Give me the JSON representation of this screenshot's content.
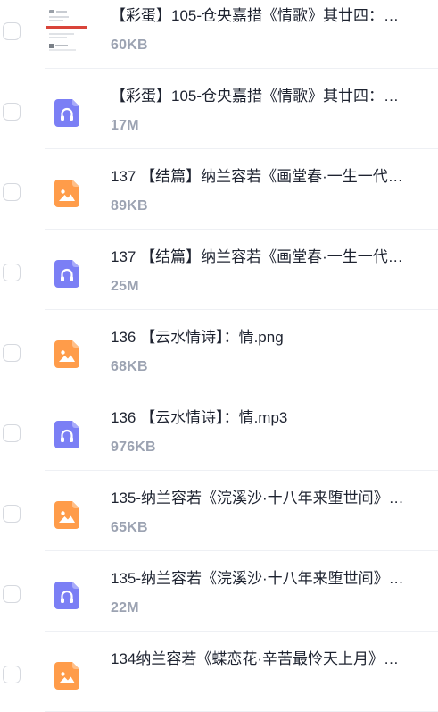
{
  "files": [
    {
      "name": "【彩蛋】105-仓央嘉措《情歌》其廿四：…",
      "size": "60KB",
      "icon": "image-thumbnail"
    },
    {
      "name": "【彩蛋】105-仓央嘉措《情歌》其廿四：…",
      "size": "17M",
      "icon": "audio-file-icon"
    },
    {
      "name": "137 【结篇】纳兰容若《画堂春·一生一代…",
      "size": "89KB",
      "icon": "image-file-icon"
    },
    {
      "name": "137 【结篇】纳兰容若《画堂春·一生一代…",
      "size": "25M",
      "icon": "audio-file-icon"
    },
    {
      "name": "136 【云水情诗】：情.png",
      "size": "68KB",
      "icon": "image-file-icon"
    },
    {
      "name": "136 【云水情诗】：情.mp3",
      "size": "976KB",
      "icon": "audio-file-icon"
    },
    {
      "name": "135-纳兰容若《浣溪沙·十八年来堕世间》…",
      "size": "65KB",
      "icon": "image-file-icon"
    },
    {
      "name": "135-纳兰容若《浣溪沙·十八年来堕世间》…",
      "size": "22M",
      "icon": "audio-file-icon"
    },
    {
      "name": "134纳兰容若《蝶恋花·辛苦最怜天上月》…",
      "size": "",
      "icon": "image-file-icon"
    }
  ],
  "colors": {
    "audio_icon": "#7b7ff5",
    "image_icon": "#ff9c4a",
    "name_text": "#1e2330",
    "size_text": "#9ca3b2",
    "divider": "#eef0f4"
  }
}
